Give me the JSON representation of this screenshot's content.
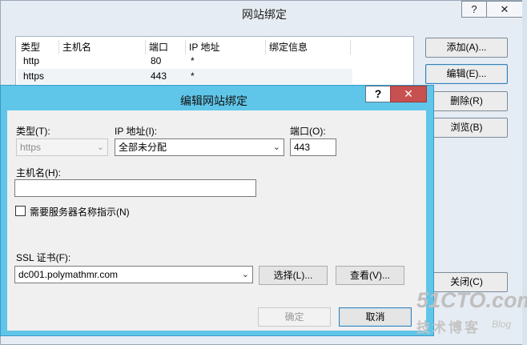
{
  "background_window": {
    "title": "网站绑定",
    "help_glyph": "?",
    "close_glyph": "✕",
    "list": {
      "columns": [
        "类型",
        "主机名",
        "端口",
        "IP 地址",
        "绑定信息"
      ],
      "rows": [
        {
          "type": "http",
          "host": "",
          "port": "80",
          "ip": "*",
          "info": ""
        },
        {
          "type": "https",
          "host": "",
          "port": "443",
          "ip": "*",
          "info": ""
        }
      ]
    },
    "buttons": {
      "add": "添加(A)...",
      "edit": "编辑(E)...",
      "remove": "删除(R)",
      "browse": "浏览(B)",
      "close": "关闭(C)"
    }
  },
  "dialog": {
    "title": "编辑网站绑定",
    "help_glyph": "?",
    "close_glyph": "✕",
    "type_label": "类型(T):",
    "type_value": "https",
    "ip_label": "IP 地址(I):",
    "ip_value": "全部未分配",
    "port_label": "端口(O):",
    "port_value": "443",
    "host_label": "主机名(H):",
    "host_value": "",
    "sni_label": "需要服务器名称指示(N)",
    "sni_checked": false,
    "ssl_label": "SSL 证书(F):",
    "ssl_value": "dc001.polymathmr.com",
    "select_button": "选择(L)...",
    "view_button": "查看(V)...",
    "ok_button": "确定",
    "cancel_button": "取消",
    "dropdown_glyph": "⌄"
  },
  "watermark": {
    "site": "51CTO.com",
    "tagline": "技术博客",
    "blog": "Blog"
  }
}
